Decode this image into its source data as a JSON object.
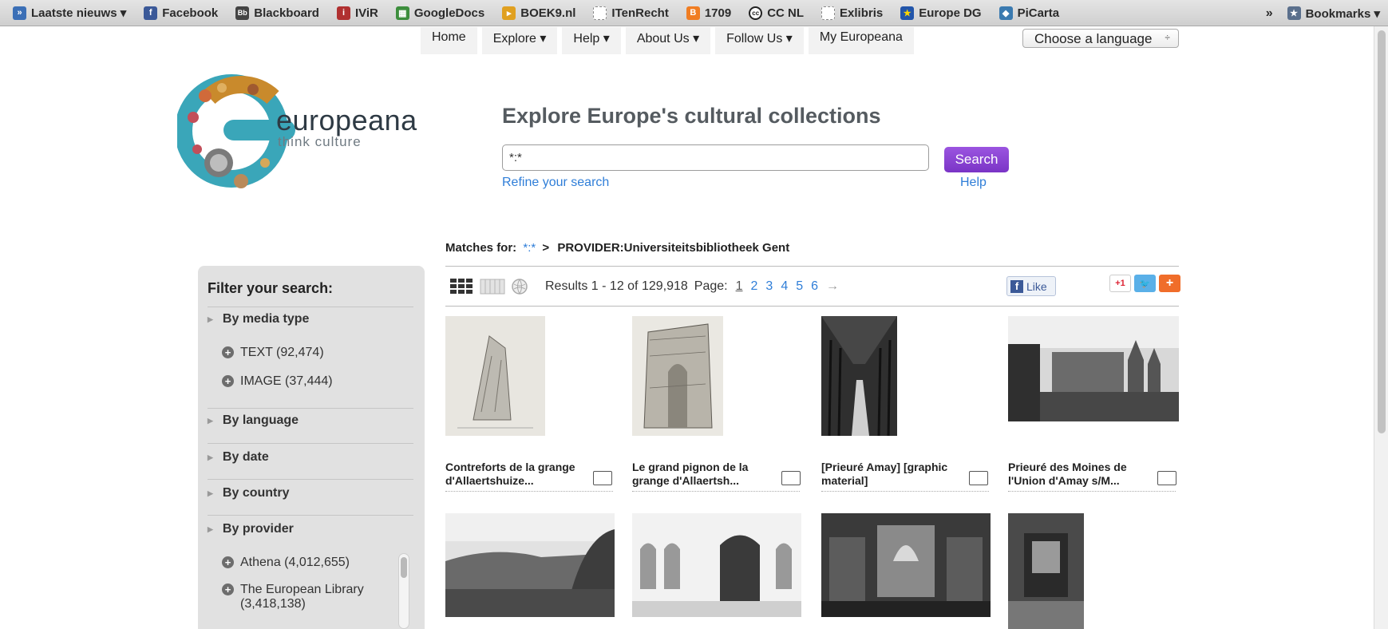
{
  "bookmarks": {
    "items": [
      {
        "label": "Laatste nieuws ▾",
        "color": "#3b6fb6",
        "glyph": "»"
      },
      {
        "label": "Facebook",
        "color": "#3b5998",
        "glyph": "f"
      },
      {
        "label": "Blackboard",
        "color": "#444444",
        "glyph": "Bb"
      },
      {
        "label": "IViR",
        "color": "#b03030",
        "glyph": "ℹ"
      },
      {
        "label": "GoogleDocs",
        "color": "#3d8e3d",
        "glyph": "▦"
      },
      {
        "label": "BOEK9.nl",
        "color": "#e0a020",
        "glyph": "▸"
      },
      {
        "label": "ITenRecht",
        "color": "#bbbbbb",
        "glyph": ""
      },
      {
        "label": "1709",
        "color": "#f07d22",
        "glyph": "B"
      },
      {
        "label": "CC NL",
        "color": "#222222",
        "glyph": "cc"
      },
      {
        "label": "Exlibris",
        "color": "#bbbbbb",
        "glyph": ""
      },
      {
        "label": "Europe DG",
        "color": "#2255aa",
        "glyph": "★"
      },
      {
        "label": "PiCarta",
        "color": "#3a7ab0",
        "glyph": "◆"
      }
    ],
    "overflow": "»",
    "bookmarks_label": "Bookmarks ▾"
  },
  "nav": {
    "items": [
      "Home",
      "Explore ▾",
      "Help ▾",
      "About Us ▾",
      "Follow Us ▾",
      "My Europeana"
    ],
    "language": "Choose a language",
    "language_arrow": "÷"
  },
  "logo": {
    "title": "europeana",
    "subtitle": "think culture"
  },
  "search": {
    "headline": "Explore Europe's cultural collections",
    "value": "*:*",
    "button": "Search",
    "refine": "Refine your search",
    "help": "Help"
  },
  "matches": {
    "label": "Matches for:",
    "query": "*:*",
    "separator": ">",
    "filter": "PROVIDER:Universiteitsbibliotheek Gent"
  },
  "toolbar": {
    "results": "Results 1 - 12 of 129,918",
    "page_label": "Page:",
    "pages": [
      "1",
      "2",
      "3",
      "4",
      "5",
      "6"
    ],
    "next": "→",
    "like": "Like",
    "gplus": "+1"
  },
  "sidebar": {
    "title": "Filter your search:",
    "media_type": "By media type",
    "text_opt": "TEXT (92,474)",
    "image_opt": "IMAGE (37,444)",
    "language": "By language",
    "date": "By date",
    "country": "By country",
    "provider": "By provider",
    "athena": "Athena (4,012,655)",
    "tel_line1": "The European Library",
    "tel_line2": "(3,418,138)"
  },
  "results": [
    {
      "title1": "Contreforts de la grange",
      "title2": "d'Allaertshuize..."
    },
    {
      "title1": "Le grand pignon de la",
      "title2": "grange d'Allaertsh..."
    },
    {
      "title1": "[Prieuré Amay] [graphic",
      "title2": "material]"
    },
    {
      "title1": "Prieuré des Moines de",
      "title2": "l'Union d'Amay s/M..."
    }
  ]
}
